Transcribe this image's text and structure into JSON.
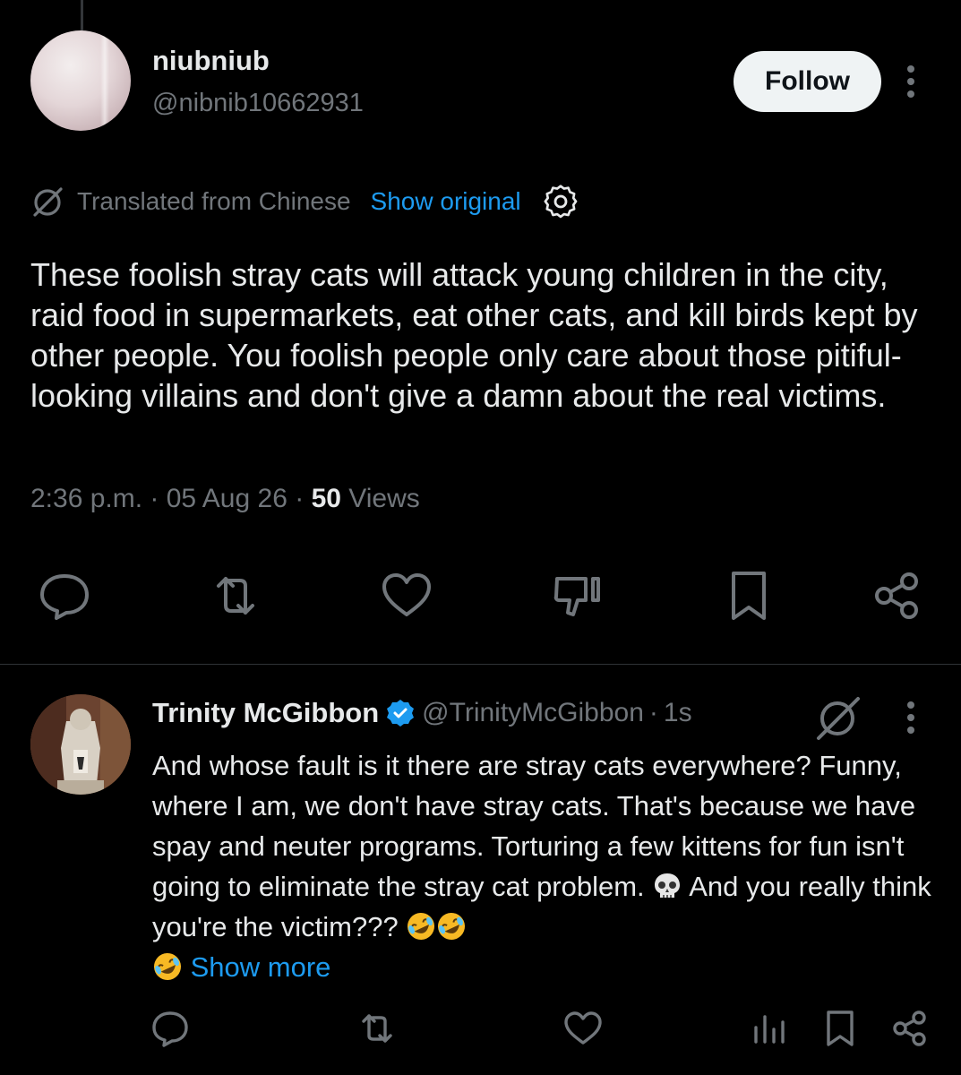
{
  "tweet": {
    "author": {
      "display_name": "niubniub",
      "handle": "@nibnib10662931"
    },
    "follow_label": "Follow",
    "translation": {
      "note": "Translated from Chinese",
      "show_original": "Show original"
    },
    "text": "These foolish stray cats will attack young children in the city, raid food in supermarkets, eat other cats, and kill birds kept by other people. You foolish people only care about those pitiful-looking villains and don't give a damn about the real victims.",
    "meta": {
      "time": "2:36 p.m.",
      "separator": " · ",
      "date": "05 Aug 26",
      "views_count": "50",
      "views_label": " Views"
    },
    "actions": [
      "reply-icon",
      "repost-icon",
      "like-icon",
      "dislike-icon",
      "bookmark-icon",
      "share-icon"
    ]
  },
  "reply": {
    "author": {
      "display_name": "Trinity McGibbon",
      "handle": "@TrinityMcGibbon",
      "separator": "·",
      "time": "1s"
    },
    "text_line1": "And whose fault is it there are stray cats everywhere? Funny, where I am, we don't have stray cats. That's because we have spay and neuter programs. Torturing a few kittens for fun isn't going to eliminate the stray cat problem. ",
    "text_line2": " And you really think you're the victim??? ",
    "show_more": "Show more",
    "emoji_names": [
      "skull-emoji",
      "rolling-laughing-emoji"
    ],
    "actions": [
      "reply-icon",
      "repost-icon",
      "like-icon",
      "views-icon",
      "bookmark-icon",
      "share-icon"
    ]
  },
  "colors": {
    "background": "#000000",
    "text": "#e7e9ea",
    "secondary": "#71767b",
    "link": "#1d9bf0",
    "verified": "#1d9bf0"
  }
}
